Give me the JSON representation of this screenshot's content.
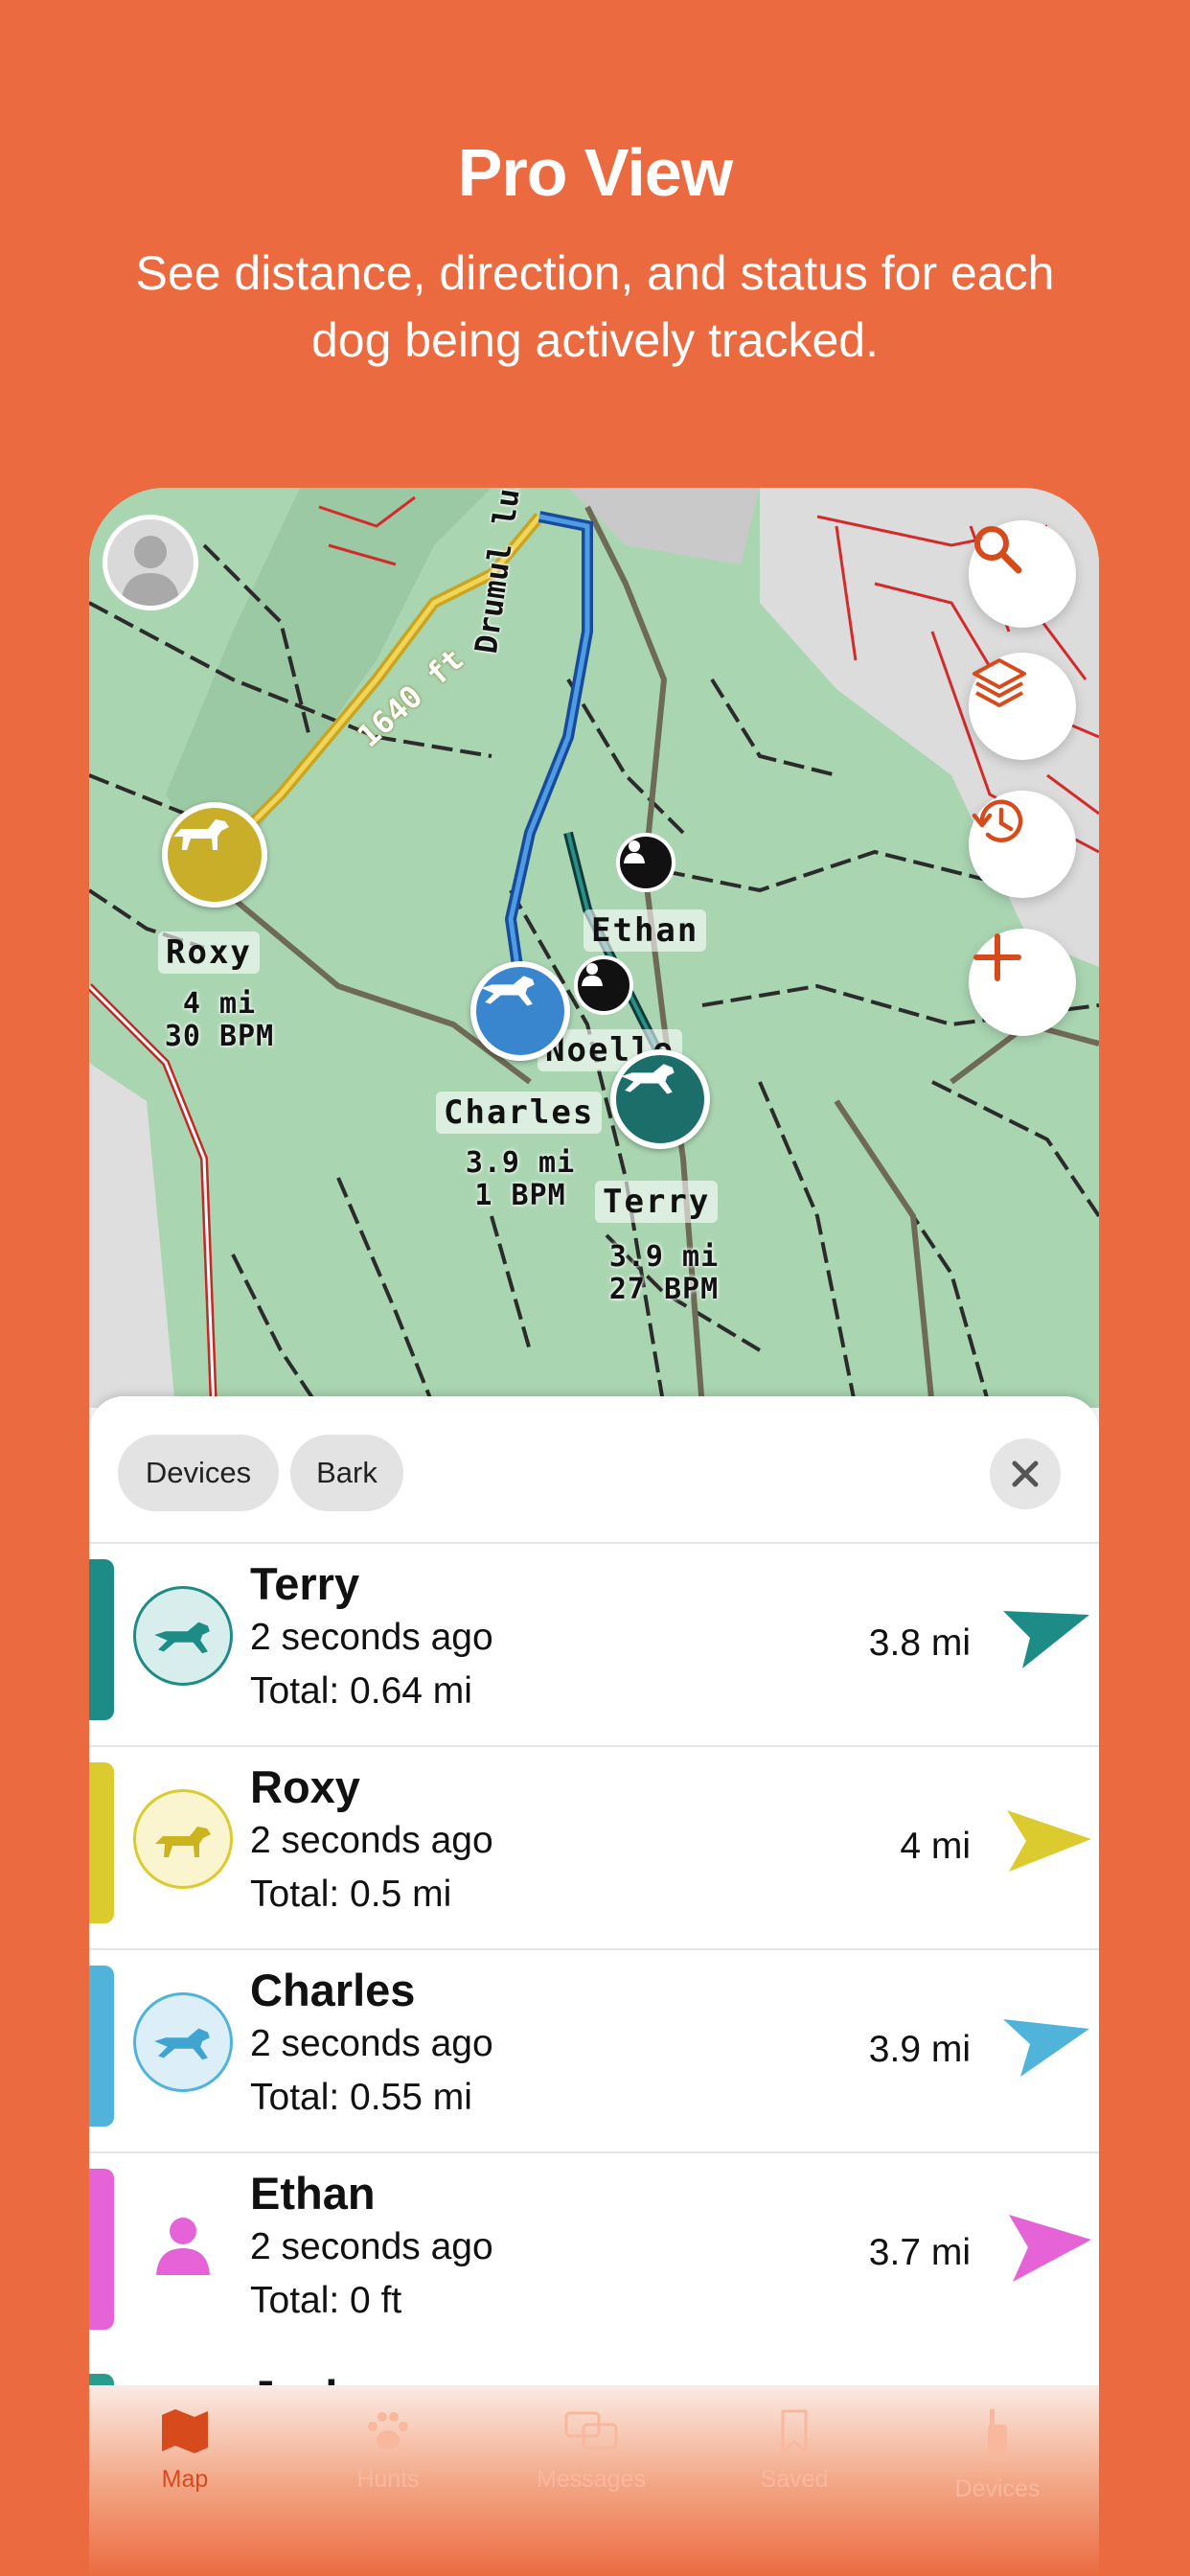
{
  "header": {
    "title": "Pro View",
    "subtitle": "See distance, direction, and status for each dog being actively tracked."
  },
  "colors": {
    "background": "#EB6A40",
    "accent": "#D74A1C",
    "terry": "#1E8C86",
    "roxy": "#DCCB2E",
    "charles": "#4FB3DA",
    "ethan": "#E563D7"
  },
  "map": {
    "scale_label": "1640 ft",
    "road_label": "Drumul lui Pater",
    "markers": [
      {
        "name": "Roxy",
        "detail": "4 mi\n30 BPM"
      },
      {
        "name": "Ethan",
        "detail": ""
      },
      {
        "name": "Noelle",
        "detail": ""
      },
      {
        "name": "Charles",
        "detail": "3.9 mi\n1 BPM"
      },
      {
        "name": "Terry",
        "detail": "3.9 mi\n27 BPM"
      }
    ],
    "buttons": [
      "search-icon",
      "layers-icon",
      "history-icon",
      "plus-icon"
    ]
  },
  "sheet": {
    "chips": [
      "Devices",
      "Bark"
    ],
    "rows": [
      {
        "name": "Terry",
        "updated": "2 seconds ago",
        "total": "Total: 0.64 mi",
        "distance": "3.8 mi",
        "icon": "dog-icon"
      },
      {
        "name": "Roxy",
        "updated": "2 seconds ago",
        "total": "Total: 0.5 mi",
        "distance": "4 mi",
        "icon": "dog-icon"
      },
      {
        "name": "Charles",
        "updated": "2 seconds ago",
        "total": "Total: 0.55 mi",
        "distance": "3.9 mi",
        "icon": "dog-icon"
      },
      {
        "name": "Ethan",
        "updated": "2 seconds ago",
        "total": "Total: 0 ft",
        "distance": "3.7 mi",
        "icon": "person-icon"
      }
    ],
    "peek_name": "Jack"
  },
  "tabs": [
    {
      "label": "Map",
      "icon": "map-icon",
      "active": true
    },
    {
      "label": "Hunts",
      "icon": "paw-icon",
      "active": false
    },
    {
      "label": "Messages",
      "icon": "messages-icon",
      "active": false
    },
    {
      "label": "Saved",
      "icon": "bookmark-icon",
      "active": false
    },
    {
      "label": "Devices",
      "icon": "device-icon",
      "active": false
    }
  ]
}
